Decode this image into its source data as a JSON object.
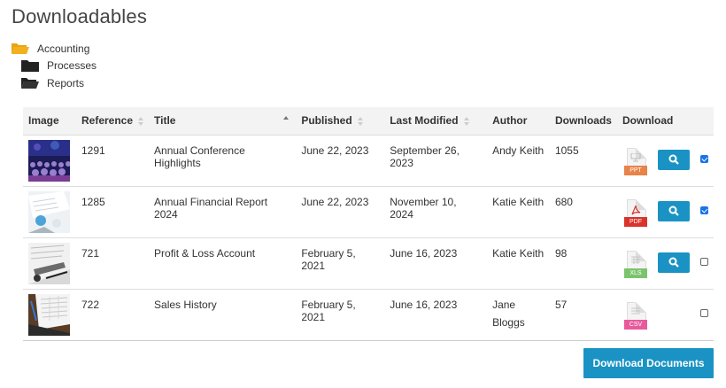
{
  "page": {
    "title": "Downloadables"
  },
  "tree": {
    "root": {
      "label": "Accounting",
      "icon": "open-folder-icon"
    },
    "children": [
      {
        "label": "Processes",
        "icon": "folder-icon"
      },
      {
        "label": "Reports",
        "icon": "open-folder-icon"
      }
    ]
  },
  "table": {
    "headers": {
      "image": "Image",
      "reference": "Reference",
      "title": "Title",
      "published": "Published",
      "last_modified": "Last Modified",
      "author": "Author",
      "downloads": "Downloads",
      "download": "Download"
    },
    "sorted_column": "title",
    "rows": [
      {
        "reference": "1291",
        "title": "Annual Conference Highlights",
        "published": "June 22, 2023",
        "last_modified": "September 26, 2023",
        "author": "Andy Keith",
        "downloads": "1055",
        "file_type": "PPT",
        "file_color": "#e8834a",
        "has_view": true,
        "checked": true
      },
      {
        "reference": "1285",
        "title": "Annual Financial Report 2024",
        "published": "June 22, 2023",
        "last_modified": "November 10, 2024",
        "author": "Katie Keith",
        "downloads": "680",
        "file_type": "PDF",
        "file_color": "#d9332b",
        "has_view": true,
        "checked": true
      },
      {
        "reference": "721",
        "title": "Profit & Loss Account",
        "published": "February 5, 2021",
        "last_modified": "June 16, 2023",
        "author": "Katie Keith",
        "downloads": "98",
        "file_type": "XLS",
        "file_color": "#7cc36e",
        "has_view": true,
        "checked": false
      },
      {
        "reference": "722",
        "title": "Sales History",
        "published": "February 5, 2021",
        "last_modified": "June 16, 2023",
        "author": "Jane Bloggs",
        "downloads": "57",
        "file_type": "CSV",
        "file_color": "#e85a9c",
        "has_view": false,
        "checked": false
      }
    ]
  },
  "actions": {
    "download_documents": "Download Documents"
  },
  "colors": {
    "accent": "#1a93c4",
    "folder": "#f2b01e",
    "folder_dark": "#222222"
  }
}
